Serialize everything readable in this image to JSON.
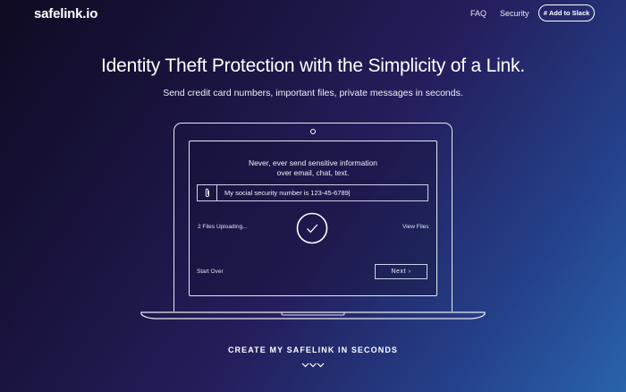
{
  "nav": {
    "logo": "safelink.io",
    "links": [
      "FAQ",
      "Security"
    ],
    "slack_button": "Add to Slack"
  },
  "hero": {
    "title": "Identity Theft Protection with the Simplicity of a Link.",
    "subtitle": "Send credit card numbers, important files, private messages in seconds."
  },
  "demo": {
    "prompt_line1": "Never, ever send sensitive information",
    "prompt_line2": "over email, chat, text.",
    "message_value": "My social security number is 123-45-6789|",
    "uploading_status": "2 Files Uploading...",
    "view_files": "View Files",
    "start_over": "Start Over",
    "next_label": "Next ›"
  },
  "cta": {
    "label": "CREATE MY SAFELINK IN SECONDS"
  },
  "icons": {
    "slack": "slack-hash-icon",
    "attach": "paperclip-icon",
    "check": "checkmark-circle-icon",
    "scroll": "triple-chevron-down-icon",
    "camera": "camera-dot-icon"
  }
}
